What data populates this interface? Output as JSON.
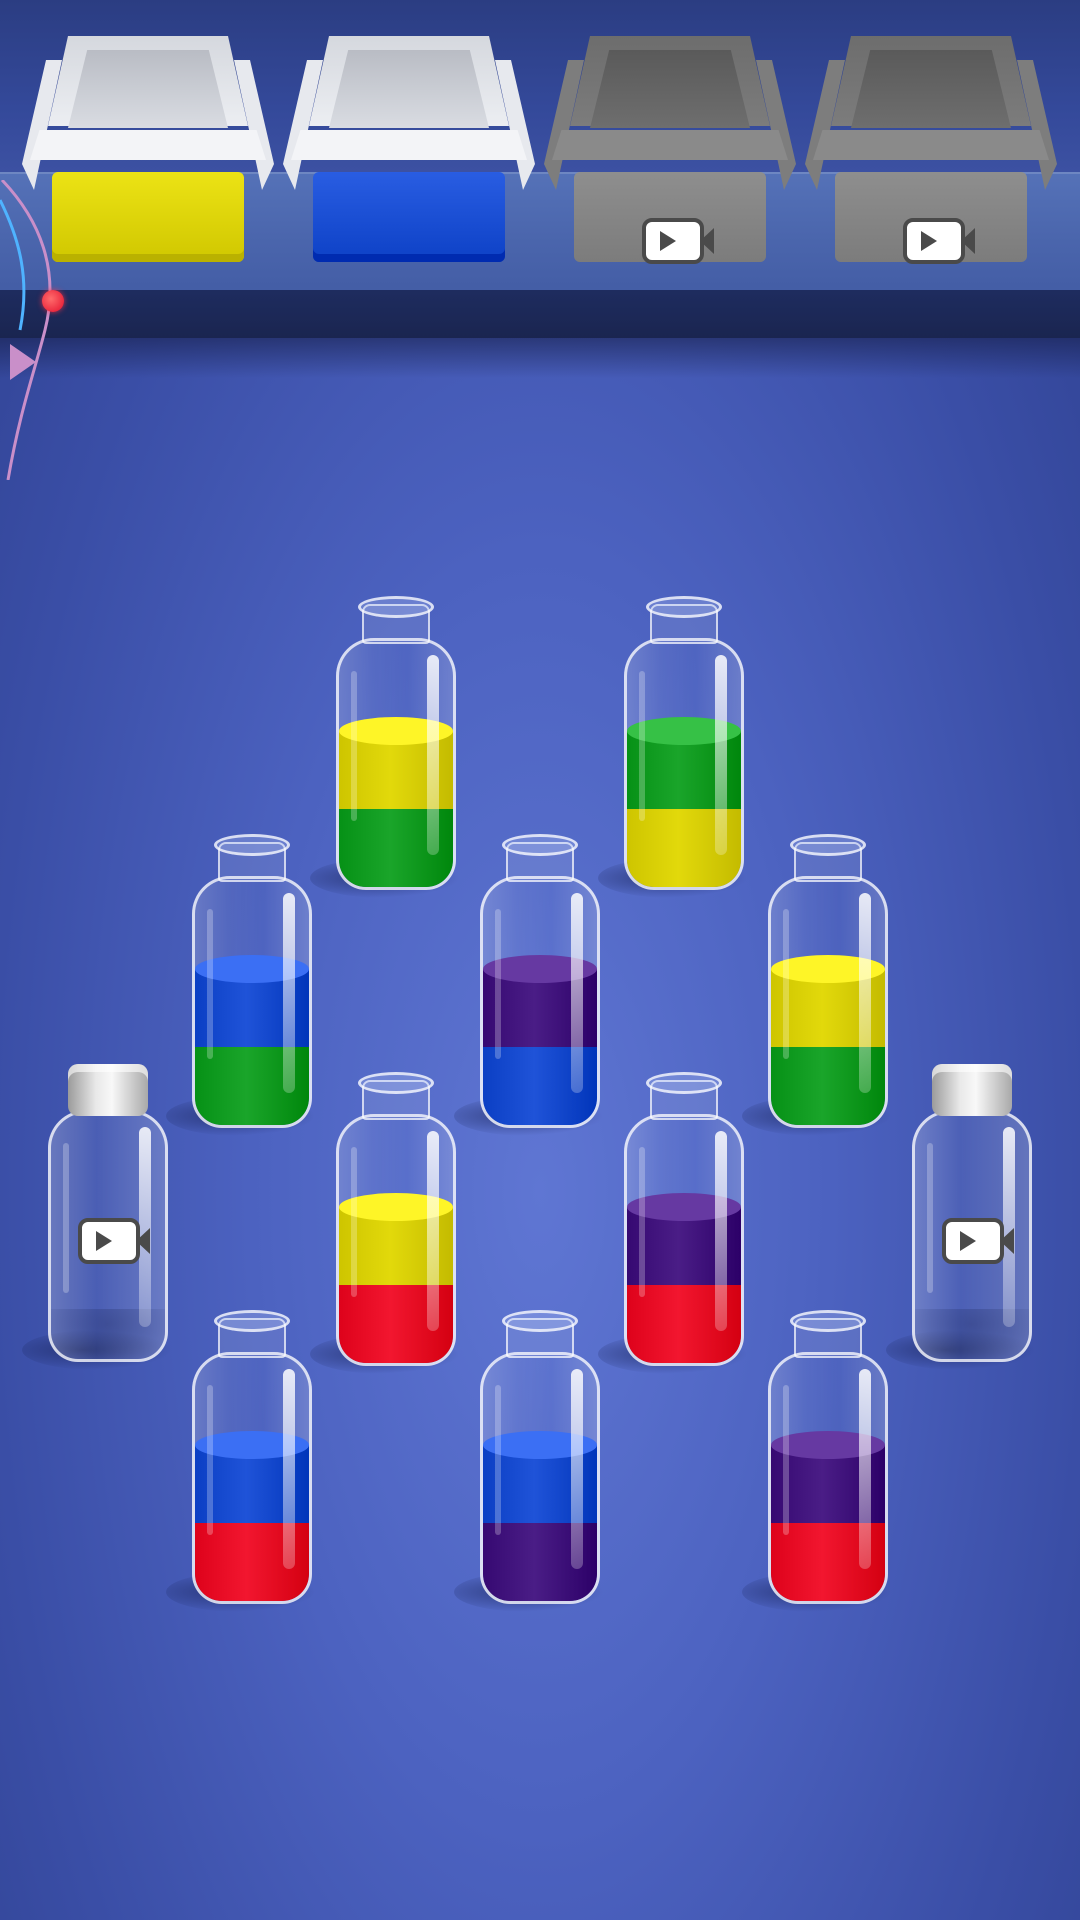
{
  "colors": {
    "yellow": "#e2d90b",
    "blue": "#1f53d8",
    "green": "#1aa52a",
    "purple": "#4a1d86",
    "red": "#f2162f"
  },
  "boxes": [
    {
      "id": "box-yellow",
      "state": "unlocked",
      "color": "yellow"
    },
    {
      "id": "box-blue",
      "state": "unlocked",
      "color": "blue"
    },
    {
      "id": "box-locked-1",
      "state": "locked",
      "icon": "video-ad-icon"
    },
    {
      "id": "box-locked-2",
      "state": "locked",
      "icon": "video-ad-icon"
    }
  ],
  "bottles": [
    {
      "id": "bottle-1",
      "layers": [
        "green",
        "yellow"
      ]
    },
    {
      "id": "bottle-2",
      "layers": [
        "yellow",
        "green"
      ]
    },
    {
      "id": "bottle-3",
      "layers": [
        "green",
        "blue"
      ]
    },
    {
      "id": "bottle-4",
      "layers": [
        "blue",
        "purple"
      ]
    },
    {
      "id": "bottle-5",
      "layers": [
        "green",
        "yellow"
      ]
    },
    {
      "id": "bottle-6",
      "locked": true,
      "icon": "video-ad-icon"
    },
    {
      "id": "bottle-7",
      "layers": [
        "red",
        "yellow"
      ]
    },
    {
      "id": "bottle-8",
      "layers": [
        "red",
        "purple"
      ]
    },
    {
      "id": "bottle-9",
      "locked": true,
      "icon": "video-ad-icon"
    },
    {
      "id": "bottle-10",
      "layers": [
        "red",
        "blue"
      ]
    },
    {
      "id": "bottle-11",
      "layers": [
        "purple",
        "blue"
      ]
    },
    {
      "id": "bottle-12",
      "layers": [
        "red",
        "purple"
      ]
    }
  ]
}
